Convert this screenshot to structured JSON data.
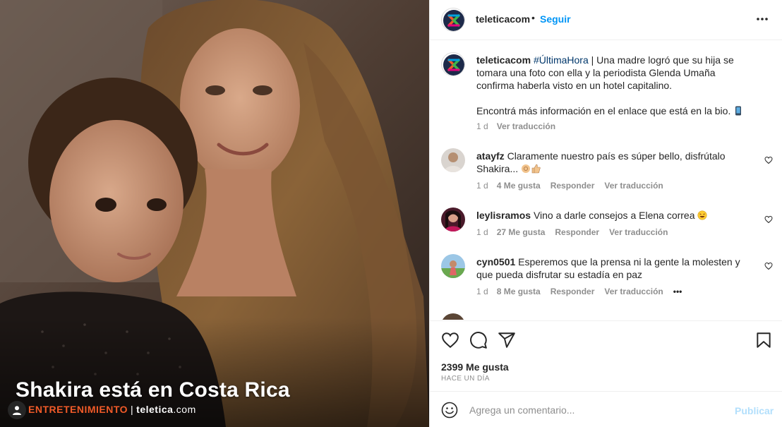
{
  "post": {
    "image_overlay": {
      "title": "Shakira está en Costa Rica",
      "category": "ENTRETENIMIENTO",
      "brand_main": "teletica",
      "brand_domain": ".com"
    }
  },
  "header": {
    "username": "teleticacom",
    "separator": "•",
    "follow_label": "Seguir"
  },
  "caption": {
    "username": "teleticacom",
    "hashtag": "#ÚltimaHora",
    "text_line1": " | Una madre logró que su hija se tomara una foto con ella y la periodista Glenda Umaña confirma haberla visto en un hotel capitalino.",
    "text_line2": "Encontrá más información en el enlace que está en la bio.",
    "time": "1 d",
    "translate": "Ver traducción"
  },
  "comments": [
    {
      "username": "atayfz",
      "text": "Claramente nuestro país es súper bello, disfrútalo Shakira...",
      "time": "1 d",
      "likes": "4 Me gusta",
      "reply": "Responder",
      "translate": "Ver traducción"
    },
    {
      "username": "leylisramos",
      "text": "Vino a darle consejos a Elena correa",
      "time": "1 d",
      "likes": "27 Me gusta",
      "reply": "Responder",
      "translate": "Ver traducción"
    },
    {
      "username": "cyn0501",
      "text": "Esperemos que la prensa ni la gente la molesten y que pueda disfrutar su estadía en paz",
      "time": "1 d",
      "likes": "8 Me gusta",
      "reply": "Responder",
      "translate": "Ver traducción",
      "more": "•••"
    }
  ],
  "stats": {
    "likes": "2399 Me gusta",
    "posted": "HACE UN DÍA"
  },
  "add_comment": {
    "placeholder": "Agrega un comentario...",
    "post_label": "Publicar"
  },
  "colors": {
    "link_blue": "#0095f6",
    "muted": "#8e8e8e",
    "category_orange": "#f05a28",
    "post_disabled": "#b2dffc"
  },
  "icons": [
    "user-icon",
    "more-options-icon",
    "heart-icon",
    "comment-icon",
    "share-icon",
    "save-icon",
    "emoji-icon",
    "hands-emoji-icon",
    "laugh-emoji-icon",
    "phone-emoji-icon"
  ]
}
